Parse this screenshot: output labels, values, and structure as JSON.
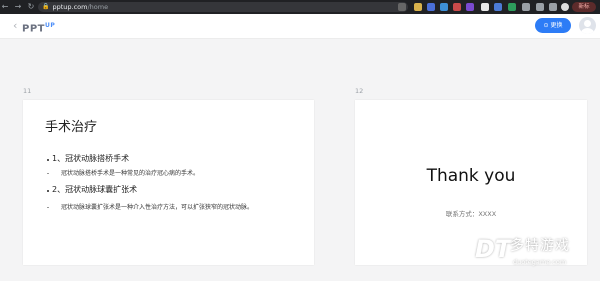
{
  "browser": {
    "url_host": "pptup.com",
    "url_path": "/home",
    "profile_label": "新标"
  },
  "app": {
    "logo_text": "PPT",
    "logo_suffix": "UP",
    "change_button_label": "更换"
  },
  "slides": [
    {
      "number": "11",
      "title": "手术治疗",
      "items": [
        {
          "level": 1,
          "text": "1、冠状动脉搭桥手术"
        },
        {
          "level": 2,
          "text": "冠状动脉搭桥手术是一种常见的治疗冠心病的手术。"
        },
        {
          "level": 1,
          "text": "2、冠状动脉球囊扩张术"
        },
        {
          "level": 2,
          "text": "冠状动脉球囊扩张术是一种介入性治疗方法，可以扩张狭窄的冠状动脉。"
        }
      ]
    },
    {
      "number": "12",
      "title": "Thank you",
      "subtitle": "联系方式：XXXX"
    }
  ],
  "watermark": {
    "logo": "DT",
    "name": "多特游戏",
    "url": "duotegame.com"
  }
}
